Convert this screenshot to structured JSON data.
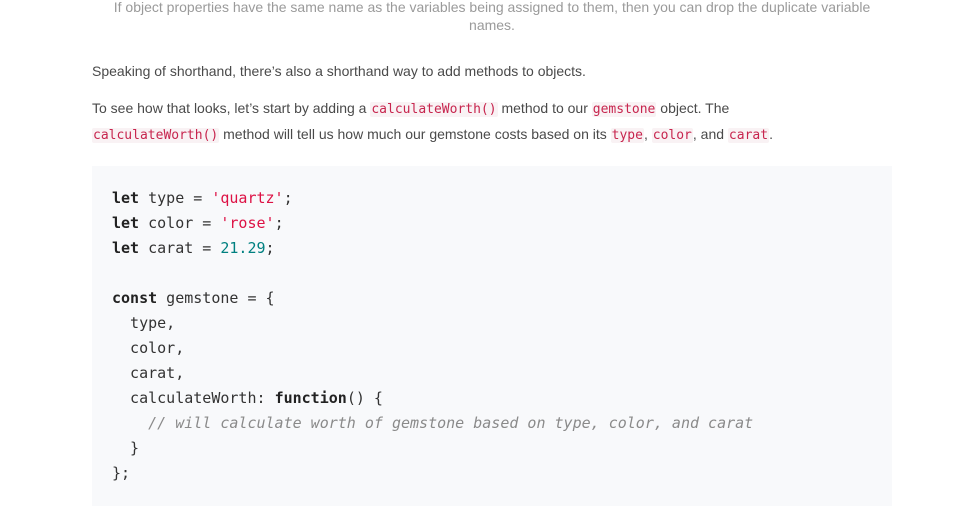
{
  "caption": "If object properties have the same name as the variables being assigned to them, then you can drop the duplicate variable names.",
  "paragraph1": "Speaking of shorthand, there’s also a shorthand way to add methods to objects.",
  "paragraph2": {
    "t1": "To see how that looks, let’s start by adding a ",
    "c1": "calculateWorth()",
    "t2": " method to our ",
    "c2": "gemstone",
    "t3": " object. The ",
    "c3": "calculateWorth()",
    "t4": " method will tell us how much our gemstone costs based on its ",
    "c4": "type",
    "t5": ", ",
    "c5": "color",
    "t6": ", and ",
    "c6": "carat",
    "t7": "."
  },
  "code": {
    "l1_kw": "let",
    "l1_rest": " type = ",
    "l1_str": "'quartz'",
    "l1_end": ";",
    "l2_kw": "let",
    "l2_rest": " color = ",
    "l2_str": "'rose'",
    "l2_end": ";",
    "l3_kw": "let",
    "l3_rest": " carat = ",
    "l3_num": "21.29",
    "l3_end": ";",
    "l5_kw": "const",
    "l5_rest": " gemstone = {",
    "l6": "  type,",
    "l7": "  color,",
    "l8": "  carat,",
    "l9_pre": "  calculateWorth: ",
    "l9_kw": "function",
    "l9_end": "() {",
    "l10_indent": "    ",
    "l10_comment": "// will calculate worth of gemstone based on type, color, and carat",
    "l11": "  }",
    "l12": "};"
  }
}
